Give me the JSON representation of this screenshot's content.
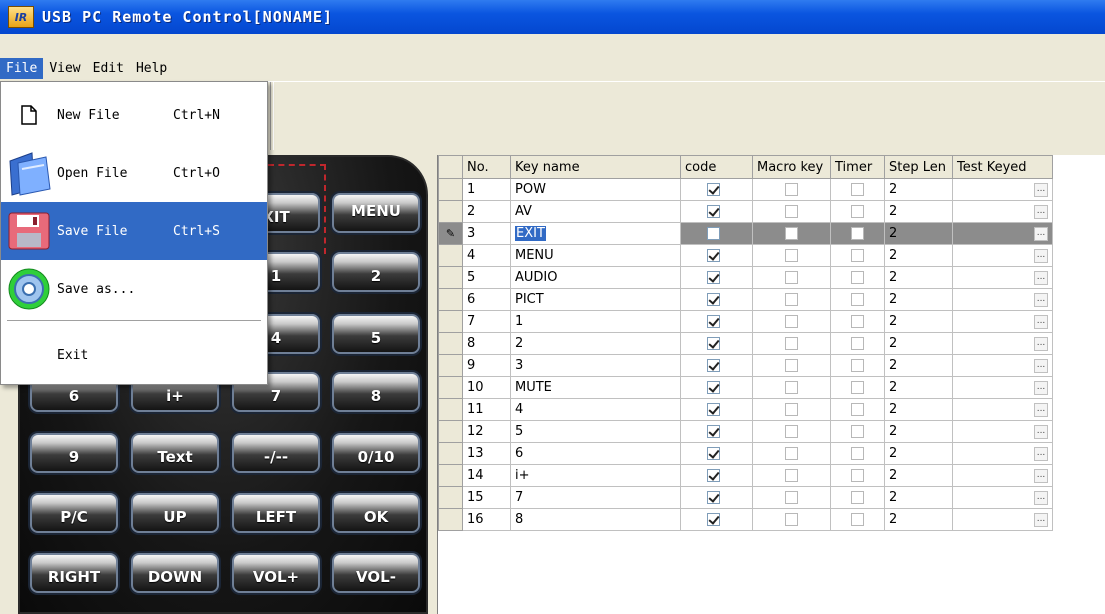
{
  "window": {
    "icon_text": "IR",
    "title": "USB PC Remote Control[NONAME]"
  },
  "menubar": [
    "File",
    "View",
    "Edit",
    "Help"
  ],
  "file_menu": {
    "items": [
      {
        "label": "New File",
        "shortcut": "Ctrl+N",
        "icon": "new-file-icon"
      },
      {
        "label": "Open File",
        "shortcut": "Ctrl+O",
        "icon": "open-folder-icon"
      },
      {
        "label": "Save File",
        "shortcut": "Ctrl+S",
        "icon": "floppy-disk-icon",
        "highlighted": true
      },
      {
        "label": "Save as...",
        "shortcut": "",
        "icon": "save-as-gear-icon"
      },
      {
        "label": "Exit",
        "shortcut": ""
      }
    ]
  },
  "remote": {
    "buttons": [
      [
        "",
        "",
        "",
        "MENU"
      ],
      [
        "",
        "",
        "",
        "2"
      ],
      [
        "",
        "",
        "",
        "5"
      ],
      [
        "6",
        "i+",
        "7",
        "8"
      ],
      [
        "9",
        "Text",
        "-/--",
        "0/10"
      ],
      [
        "P/C",
        "UP",
        "LEFT",
        "OK"
      ],
      [
        "RIGHT",
        "DOWN",
        "VOL+",
        "VOL-"
      ]
    ],
    "partial_labels": [
      "XIT",
      "1",
      "4"
    ]
  },
  "table": {
    "columns": [
      "No.",
      "Key name",
      "code",
      "Macro key",
      "Timer",
      "Step Len",
      "Test Keyed"
    ],
    "selected_row": 3,
    "rows": [
      {
        "no": "1",
        "name": "POW",
        "code": true,
        "macro": false,
        "timer": false,
        "step": "2"
      },
      {
        "no": "2",
        "name": "AV",
        "code": true,
        "macro": false,
        "timer": false,
        "step": "2"
      },
      {
        "no": "3",
        "name": "EXIT",
        "code": false,
        "macro": false,
        "timer": false,
        "step": "2"
      },
      {
        "no": "4",
        "name": "MENU",
        "code": true,
        "macro": false,
        "timer": false,
        "step": "2"
      },
      {
        "no": "5",
        "name": "AUDIO",
        "code": true,
        "macro": false,
        "timer": false,
        "step": "2"
      },
      {
        "no": "6",
        "name": "PICT",
        "code": true,
        "macro": false,
        "timer": false,
        "step": "2"
      },
      {
        "no": "7",
        "name": "1",
        "code": true,
        "macro": false,
        "timer": false,
        "step": "2"
      },
      {
        "no": "8",
        "name": "2",
        "code": true,
        "macro": false,
        "timer": false,
        "step": "2"
      },
      {
        "no": "9",
        "name": "3",
        "code": true,
        "macro": false,
        "timer": false,
        "step": "2"
      },
      {
        "no": "10",
        "name": "MUTE",
        "code": true,
        "macro": false,
        "timer": false,
        "step": "2"
      },
      {
        "no": "11",
        "name": "4",
        "code": true,
        "macro": false,
        "timer": false,
        "step": "2"
      },
      {
        "no": "12",
        "name": "5",
        "code": true,
        "macro": false,
        "timer": false,
        "step": "2"
      },
      {
        "no": "13",
        "name": "6",
        "code": true,
        "macro": false,
        "timer": false,
        "step": "2"
      },
      {
        "no": "14",
        "name": "i+",
        "code": true,
        "macro": false,
        "timer": false,
        "step": "2"
      },
      {
        "no": "15",
        "name": "7",
        "code": true,
        "macro": false,
        "timer": false,
        "step": "2"
      },
      {
        "no": "16",
        "name": "8",
        "code": true,
        "macro": false,
        "timer": false,
        "step": "2"
      }
    ],
    "dots_label": "...",
    "edit_indicator": "✎"
  },
  "colors": {
    "menu_highlight": "#316ac5",
    "titlebar": "#0a55e0",
    "remote_body": "#161616"
  }
}
